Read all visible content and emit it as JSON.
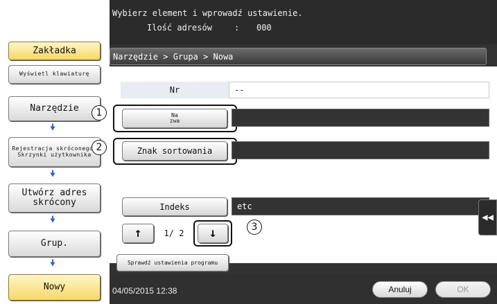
{
  "header": {
    "instruction": "Wybierz element i wprowadź ustawienie.",
    "address_count_label": "Ilość adresów",
    "address_count_sep": ":",
    "address_count_value": "000"
  },
  "sidebar": {
    "tab_bookmark": "Zakładka",
    "show_keyboard": "Wyświetl klawiaturę",
    "steps": [
      "Narzędzie",
      "Rejestracja skróconego/ Skrzynki użytkownika",
      "Utwórz adres skrócony",
      "Grup.",
      "Nowy"
    ]
  },
  "breadcrumb": "Narzędzie > Grupa > Nowa",
  "form": {
    "nr_label": "Nr",
    "nr_value": "--",
    "name_button": "Na zwa",
    "sort_button": "Znak sortowania",
    "index_button": "Indeks",
    "index_value": "etc",
    "page_indicator": "1/ 2",
    "check_settings": "Sprawdź ustawienia programu"
  },
  "callouts": [
    "1",
    "2",
    "3"
  ],
  "footer": {
    "datetime": "04/05/2015  12:38",
    "cancel": "Anuluj",
    "ok": "OK"
  }
}
